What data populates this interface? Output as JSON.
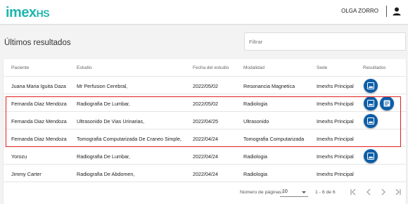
{
  "header": {
    "logo_main": "imex",
    "logo_suffix": "HS",
    "user_name": "OLGA ZORRO"
  },
  "page": {
    "title": "Últimos resultados",
    "filter_placeholder": "Filtrar"
  },
  "table": {
    "columns": [
      "Paciente",
      "Estudio",
      "Fecha del estudio",
      "Modalidad",
      "Sede",
      "Resultados"
    ],
    "rows": [
      {
        "paciente": "Juana Maria Iguita Daza",
        "estudio": "Mr Perfusion Cerebral,",
        "fecha": "2022/05/02",
        "modalidad": "Resonancia Magnetica",
        "sede": "Imexhs Principal",
        "results": [
          "image-icon"
        ]
      },
      {
        "paciente": "Fernanda Diaz Mendoza",
        "estudio": "Radiografia De Lumbar,",
        "fecha": "2022/05/02",
        "modalidad": "Radiologia",
        "sede": "Imexhs Principal",
        "results": [
          "image-icon",
          "report-icon"
        ]
      },
      {
        "paciente": "Fernanda Diaz Mendoza",
        "estudio": "Ultrasonido De Vias Urinarias,",
        "fecha": "2022/04/25",
        "modalidad": "Ultrasonido",
        "sede": "Imexhs Principal",
        "results": [
          "image-icon"
        ]
      },
      {
        "paciente": "Fernanda Diaz Mendoza",
        "estudio": "Tomografia Computarizada De Craneo Simple,",
        "fecha": "2022/04/24",
        "modalidad": "Tomografia Computarizada",
        "sede": "Imexhs Principal",
        "results": []
      },
      {
        "paciente": "Yorozu",
        "estudio": "Radiografia De Lumbar,",
        "fecha": "2022/04/24",
        "modalidad": "Radiologia",
        "sede": "Imexhs Principal",
        "results": [
          "image-icon"
        ]
      },
      {
        "paciente": "Jimmy Carter",
        "estudio": "Radiografia De Abdomen,",
        "fecha": "2022/04/24",
        "modalidad": "Radiologia",
        "sede": "Imexhs Principal",
        "results": []
      }
    ]
  },
  "pagination": {
    "per_page_label": "Número de páginas:",
    "per_page_value": "10",
    "range_label": "1 - 6 de 6"
  },
  "colors": {
    "brand": "#1fb5ad",
    "action": "#0d5ea8",
    "highlight": "#e01e1e"
  }
}
